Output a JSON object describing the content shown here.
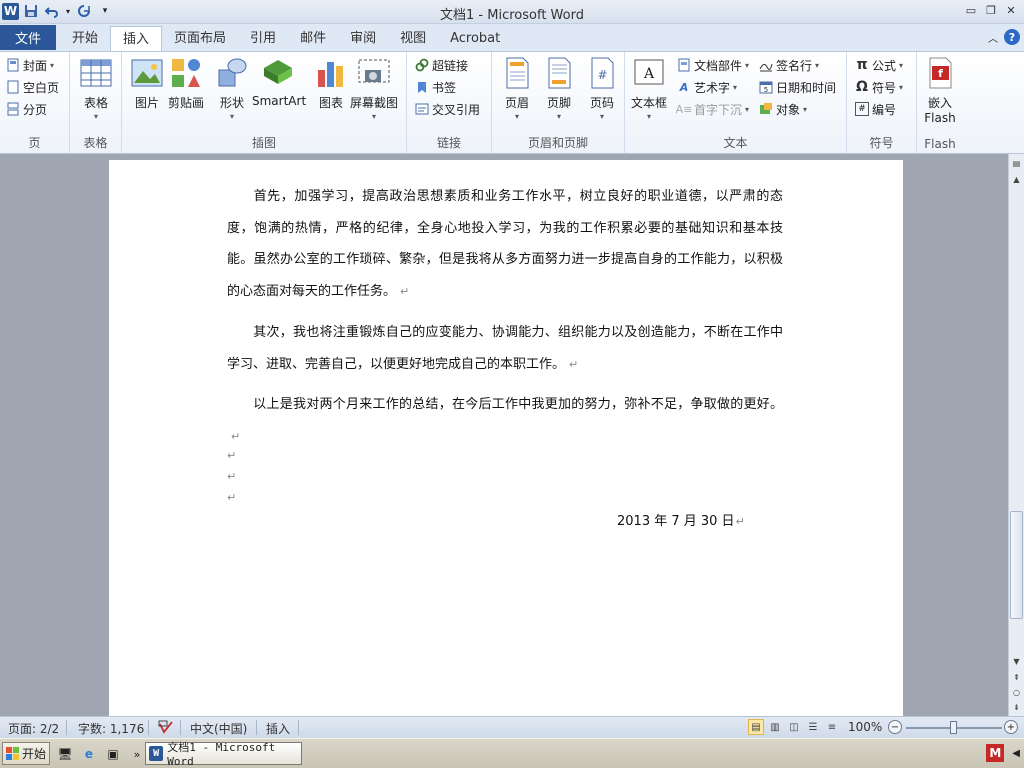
{
  "window": {
    "title": "文档1 - Microsoft Word",
    "app_logo": "W"
  },
  "quick_access": {
    "icons": [
      "save-icon",
      "undo-icon",
      "redo-icon",
      "customize-icon"
    ]
  },
  "tabs": {
    "file": "文件",
    "items": [
      "开始",
      "插入",
      "页面布局",
      "引用",
      "邮件",
      "审阅",
      "视图",
      "Acrobat"
    ],
    "active": "插入"
  },
  "ribbon": {
    "pages": {
      "label": "页",
      "cover": "封面",
      "blank": "空白页",
      "break": "分页"
    },
    "tables": {
      "label": "表格",
      "table": "表格"
    },
    "illustrations": {
      "label": "插图",
      "picture": "图片",
      "clipart": "剪贴画",
      "shapes": "形状",
      "smartart": "SmartArt",
      "chart": "图表",
      "screenshot": "屏幕截图"
    },
    "links": {
      "label": "链接",
      "hyperlink": "超链接",
      "bookmark": "书签",
      "crossref": "交叉引用"
    },
    "header_footer": {
      "label": "页眉和页脚",
      "header": "页眉",
      "footer": "页脚",
      "page_number": "页码"
    },
    "text": {
      "label": "文本",
      "textbox": "文本框",
      "quickparts": "文档部件",
      "wordart": "艺术字",
      "dropcap": "首字下沉",
      "signature": "签名行",
      "datetime": "日期和时间",
      "object": "对象"
    },
    "symbols": {
      "label": "符号",
      "equation": "公式",
      "symbol": "符号",
      "number": "编号"
    },
    "flash": {
      "label": "Flash",
      "embed_line1": "嵌入",
      "embed_line2": "Flash"
    }
  },
  "document": {
    "paragraphs": [
      "首先，加强学习，提高政治思想素质和业务工作水平，树立良好的职业道德，以严肃的态度，饱满的热情，严格的纪律，全身心地投入学习，为我的工作积累必要的基础知识和基本技能。虽然办公室的工作琐碎、繁杂，但是我将从多方面努力进一步提高自身的工作能力，以积极的心态面对每天的工作任务。",
      "其次，我也将注重锻炼自己的应变能力、协调能力、组织能力以及创造能力，不断在工作中学习、进取、完善自己，以便更好地完成自己的本职工作。",
      "以上是我对两个月来工作的总结，在今后工作中我更加的努力，弥补不足，争取做的更好。"
    ],
    "para_mark": "↵",
    "date": "2013 年 7 月 30 日"
  },
  "status": {
    "page": "页面: 2/2",
    "words": "字数: 1,176",
    "language": "中文(中国)",
    "mode": "插入",
    "zoom": "100%",
    "zoom_level": 100
  },
  "taskbar": {
    "start": "开始",
    "word_task": "文档1 - Microsoft Word"
  },
  "colors": {
    "file_tab": "#2b579a",
    "page_bg": "#ffffff",
    "workspace": "#9fa6b1"
  }
}
